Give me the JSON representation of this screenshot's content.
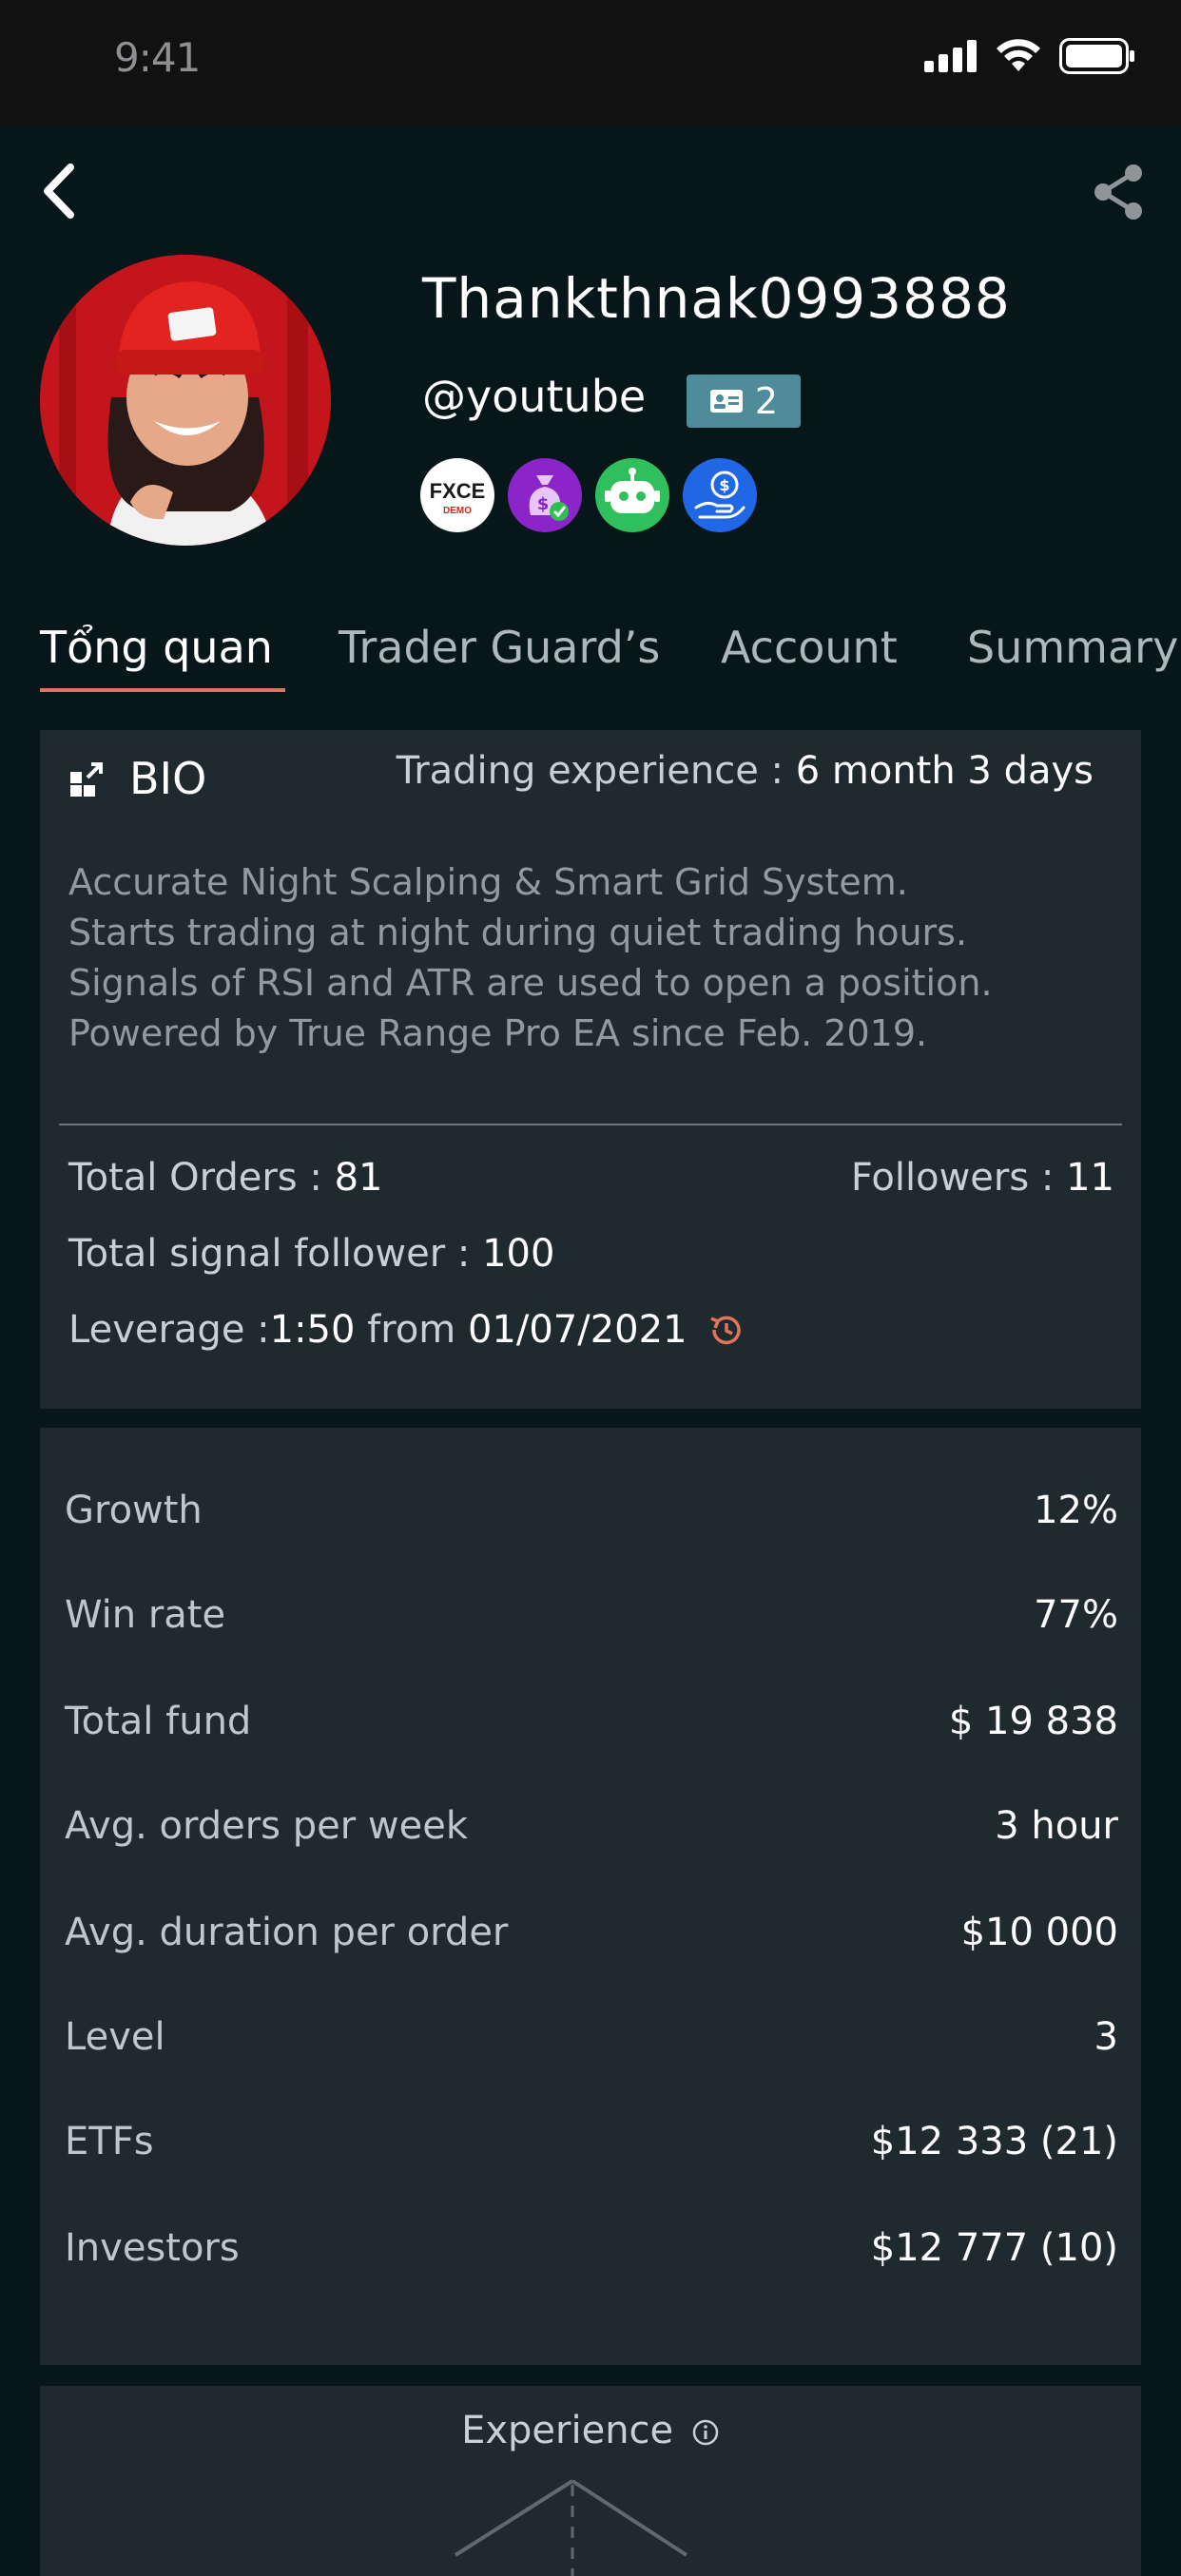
{
  "status_bar": {
    "time": "9:41"
  },
  "profile": {
    "username": "Thankthnak0993888",
    "handle": "@youtube",
    "id_badge_count": "2",
    "badges": [
      {
        "icon": "fxce-demo-badge",
        "line1": "FXCE",
        "line2": "DEMO"
      },
      {
        "icon": "money-bag-verified-badge"
      },
      {
        "icon": "robot-badge"
      },
      {
        "icon": "hand-coin-badge"
      }
    ]
  },
  "tabs": [
    "Tổng quan",
    "Trader Guard’s",
    "Account",
    "Summary"
  ],
  "bio": {
    "title": "BIO",
    "experience_label": "Trading experience : ",
    "experience_value": "6 month 3 days",
    "lines": [
      "Accurate Night Scalping & Smart Grid System.",
      "Starts trading at night during quiet trading hours.",
      "Signals of RSI and ATR are used to open a position.",
      "Powered by True Range Pro EA since Feb. 2019."
    ],
    "total_orders_label": "Total Orders : ",
    "total_orders_value": "81",
    "followers_label": "Followers : ",
    "followers_value": "11",
    "signal_follower_label": "Total signal follower : ",
    "signal_follower_value": "100",
    "leverage_label": "Leverage : ",
    "leverage_value": "1:50",
    "leverage_from": " from ",
    "leverage_date": "01/07/2021"
  },
  "metrics": [
    {
      "label": "Growth",
      "value": "12%"
    },
    {
      "label": "Win rate",
      "value": "77%"
    },
    {
      "label": "Total fund",
      "value": "$ 19 838"
    },
    {
      "label": "Avg. orders per week",
      "value": "3 hour"
    },
    {
      "label": "Avg. duration per order",
      "value": "$10 000"
    },
    {
      "label": "Level",
      "value": "3"
    },
    {
      "label": "ETFs",
      "value": "$12 333 (21)"
    },
    {
      "label": "Investors",
      "value": "$12 777 (10)"
    }
  ],
  "experience_section": {
    "title": "Experience"
  },
  "colors": {
    "accent": "#e2735c",
    "card": "#1f2a2e",
    "background": "#061619",
    "id_badge": "#4f8c99"
  }
}
